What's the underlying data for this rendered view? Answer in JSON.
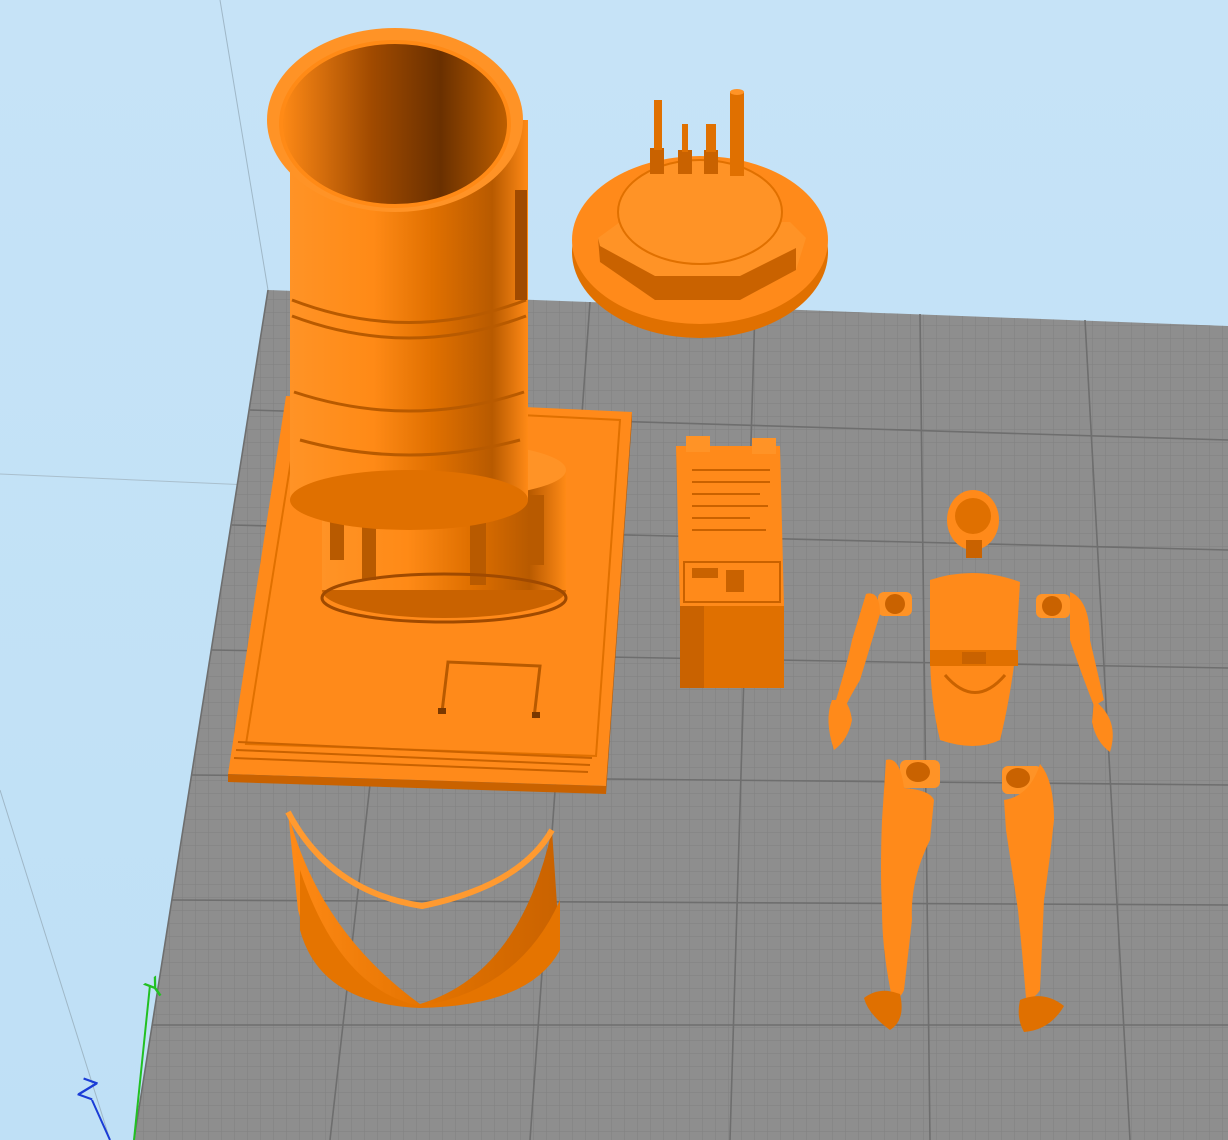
{
  "viewport": {
    "background": "#c4e2f7",
    "bed_color": "#8c8c8c",
    "bed_grid_color": "#7a7a7a",
    "model_color": "#ff8a1a",
    "model_shadow_color": "#c85e00",
    "model_dark_color": "#7a3800"
  },
  "axes": {
    "y_label": "Y",
    "z_label": "Z",
    "y_color": "#22c022",
    "z_color": "#1a3cd6"
  },
  "objects": [
    {
      "name": "tall-cylinder-shell"
    },
    {
      "name": "rectangular-base-plate"
    },
    {
      "name": "round-disc-base-with-pins"
    },
    {
      "name": "control-panel-box"
    },
    {
      "name": "curved-shell-segment"
    },
    {
      "name": "figure-head"
    },
    {
      "name": "figure-torso"
    },
    {
      "name": "figure-right-arm"
    },
    {
      "name": "figure-left-arm"
    },
    {
      "name": "figure-right-leg"
    },
    {
      "name": "figure-left-leg"
    }
  ]
}
